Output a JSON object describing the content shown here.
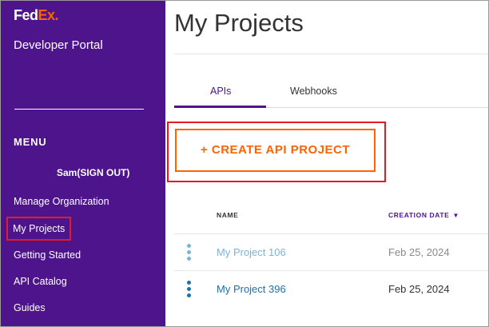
{
  "brand": {
    "logo_fed": "Fed",
    "logo_ex": "Ex",
    "suffix": ".",
    "portal_name": "Developer Portal"
  },
  "sidebar": {
    "menu_heading": "MENU",
    "user_signout": "Sam(SIGN OUT)",
    "items": [
      {
        "label": "Manage Organization"
      },
      {
        "label": "My Projects",
        "selected": true
      },
      {
        "label": "Getting Started"
      },
      {
        "label": "API Catalog"
      },
      {
        "label": "Guides"
      }
    ]
  },
  "main": {
    "title": "My Projects",
    "tabs": [
      {
        "label": "APIs",
        "active": true
      },
      {
        "label": "Webhooks",
        "active": false
      }
    ],
    "create_button": "+ CREATE API PROJECT",
    "table": {
      "columns": {
        "name": "NAME",
        "creation_date": "CREATION DATE"
      },
      "sort_icon": "caret-down-icon",
      "rows": [
        {
          "name": "My Project 106",
          "date": "Feb 25, 2024"
        },
        {
          "name": "My Project 396",
          "date": "Feb 25, 2024"
        }
      ]
    }
  },
  "colors": {
    "fedex_purple": "#4d148c",
    "fedex_orange": "#ff6200",
    "highlight_red": "#e51b24",
    "link_blue": "#1f6fa8",
    "link_blue_faded": "#7cb4d6"
  }
}
